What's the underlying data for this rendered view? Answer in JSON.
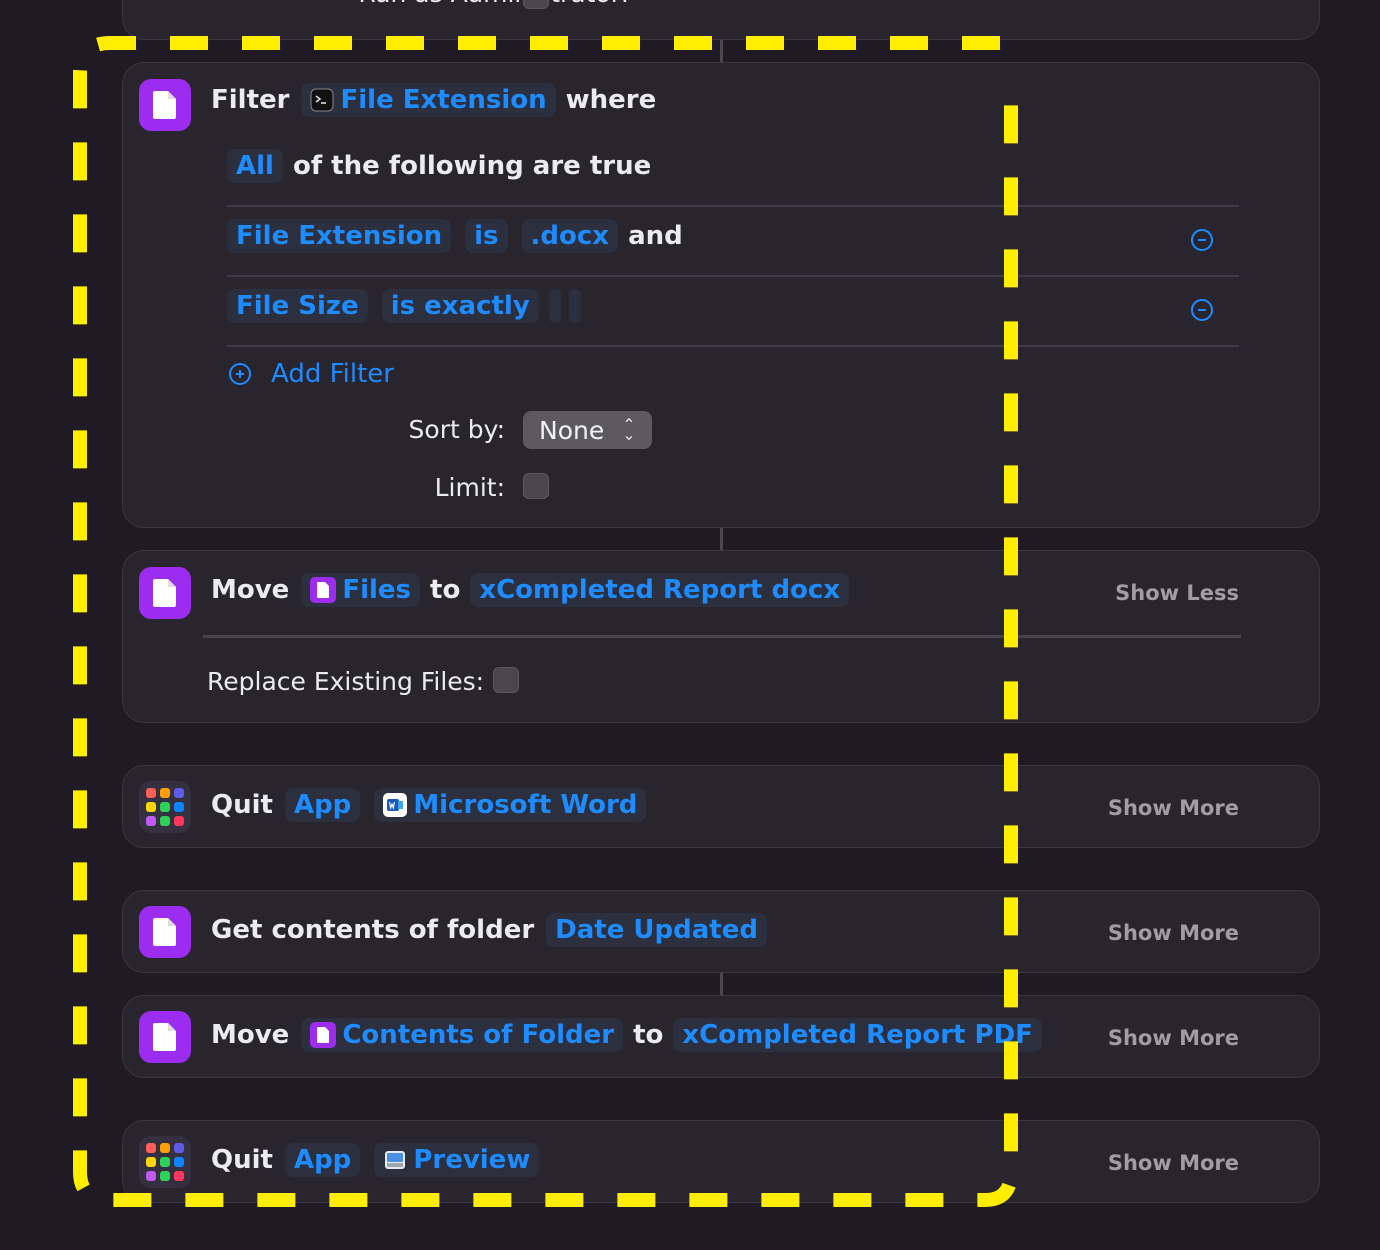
{
  "top_card": {
    "label": "Run as Administrator:"
  },
  "filter_card": {
    "action": "Filter",
    "variable": "File Extension",
    "where": "where",
    "quantifier": "All",
    "quantifier_suffix": "of the following are true",
    "conditions": [
      {
        "field": "File Extension",
        "operator": "is",
        "value": ".docx",
        "joiner": "and"
      },
      {
        "field": "File Size",
        "operator": "is exactly",
        "value": "",
        "unit": ""
      }
    ],
    "add_filter": "Add Filter",
    "sort_label": "Sort by:",
    "sort_value": "None",
    "limit_label": "Limit:"
  },
  "move_card": {
    "action": "Move",
    "source": "Files",
    "to": "to",
    "destination": "xCompleted Report docx",
    "toggle": "Show Less",
    "replace_label": "Replace Existing Files:"
  },
  "quit_word_card": {
    "action": "Quit",
    "type": "App",
    "app": "Microsoft Word",
    "toggle": "Show More"
  },
  "get_contents_card": {
    "action": "Get contents of folder",
    "folder": "Date Updated",
    "toggle": "Show More"
  },
  "move_pdf_card": {
    "action": "Move",
    "source": "Contents of Folder",
    "to": "to",
    "destination": "xCompleted Report PDF",
    "toggle": "Show More"
  },
  "quit_preview_card": {
    "action": "Quit",
    "type": "App",
    "app": "Preview",
    "toggle": "Show More"
  },
  "colors": {
    "background": "#1f1a24",
    "card": "#29252e",
    "accent": "#1e8bff",
    "file_icon": "#9b2cf0",
    "highlight": "#ffee00"
  }
}
